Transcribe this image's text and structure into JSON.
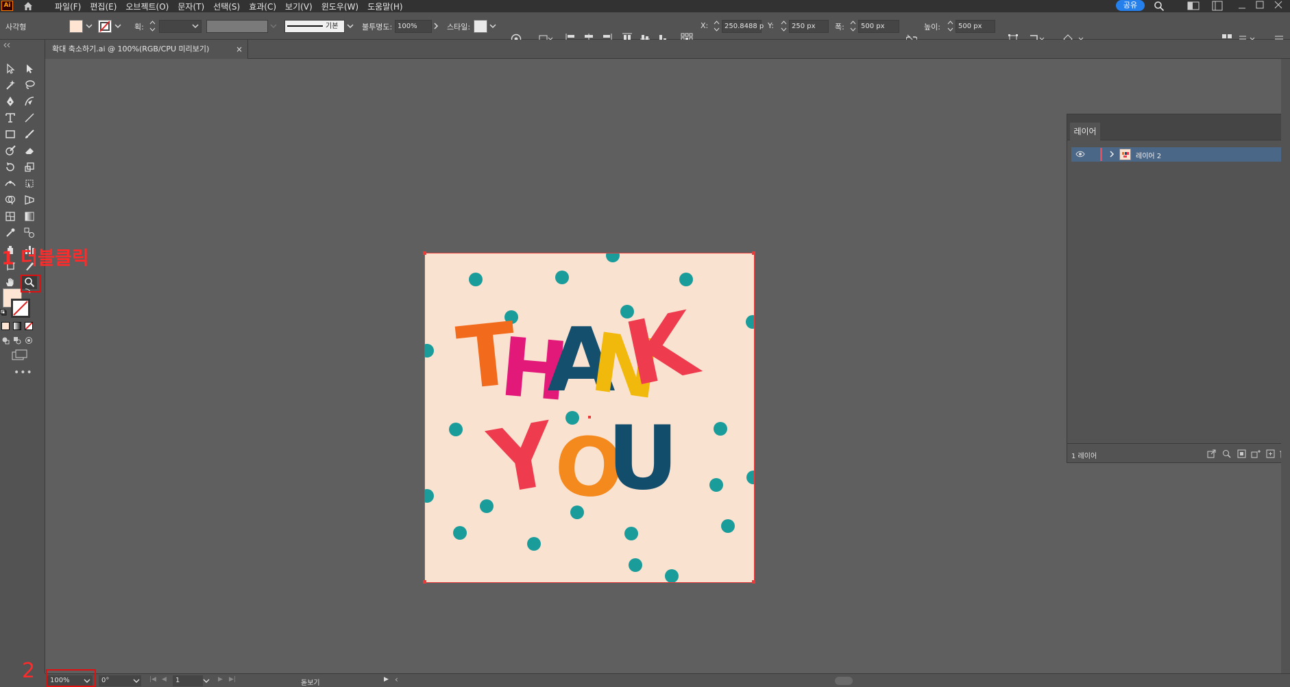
{
  "app": {
    "logo": "Ai"
  },
  "menu": [
    "파일(F)",
    "편집(E)",
    "오브젝트(O)",
    "문자(T)",
    "선택(S)",
    "효과(C)",
    "보기(V)",
    "윈도우(W)",
    "도움말(H)"
  ],
  "header": {
    "share_label": "공유"
  },
  "controlbar": {
    "object_type": "사각형",
    "fill_color": "#fde4d3",
    "stroke_label": "획:",
    "brush_label": "기본",
    "opacity_label": "불투명도:",
    "opacity_value": "100%",
    "style_label": "스타일:",
    "x_label": "X:",
    "x_value": "250.8488 p",
    "y_label": "Y:",
    "y_value": "250 px",
    "w_label": "폭:",
    "w_value": "500 px",
    "h_label": "높이:",
    "h_value": "500 px"
  },
  "document": {
    "tab_title": "확대 축소하기.ai @ 100%(RGB/CPU 미리보기)",
    "close_glyph": "×"
  },
  "artwork": {
    "background_color": "#fae2d1",
    "dot_color": "#1a9c9a",
    "line1": [
      {
        "char": "T",
        "color": "#f26a1b"
      },
      {
        "char": "H",
        "color": "#e3197a"
      },
      {
        "char": "A",
        "color": "#144f6d"
      },
      {
        "char": "N",
        "color": "#f2b90d"
      },
      {
        "char": "K",
        "color": "#ee3c4e"
      }
    ],
    "line2": [
      {
        "char": "Y",
        "color": "#ee3c4e"
      },
      {
        "char": "O",
        "color": "#f48a1e"
      },
      {
        "char": "U",
        "color": "#124e6c"
      }
    ]
  },
  "layers_panel": {
    "tab_label": "레이어",
    "layers": [
      {
        "name": "레이어 2",
        "color": "#e84c5a"
      }
    ],
    "footer_count": "1 레이어"
  },
  "statusbar": {
    "zoom": "100%",
    "rotation": "0°",
    "artboard_number": "1",
    "mode": "돋보기"
  },
  "annotations": {
    "step1_label": "1 더블클릭",
    "step2_label": "2",
    "color": "#ff2a2a"
  }
}
